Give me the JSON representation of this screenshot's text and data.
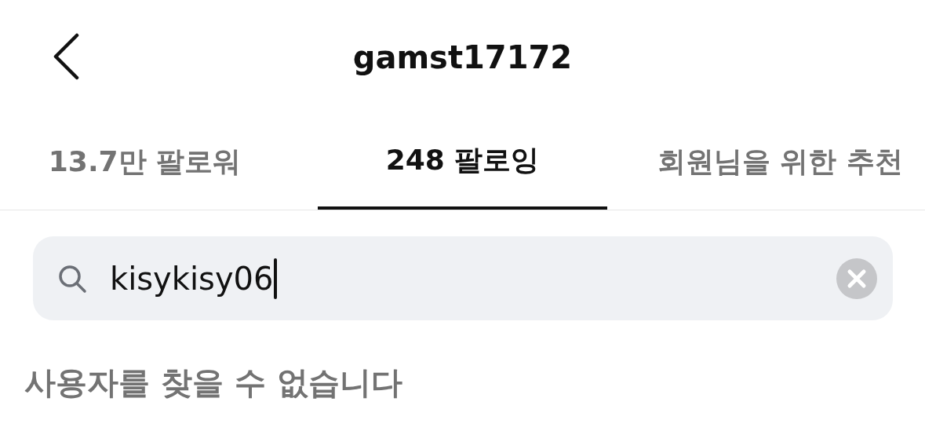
{
  "header": {
    "title": "gamst17172"
  },
  "tabs": [
    {
      "label": "13.7만 팔로워",
      "selected": false
    },
    {
      "label": "248 팔로잉",
      "selected": true
    },
    {
      "label": "회원님을 위한 추천",
      "selected": false
    }
  ],
  "search": {
    "value": "kisykisy06"
  },
  "message": "사용자를 찾을 수 없습니다"
}
